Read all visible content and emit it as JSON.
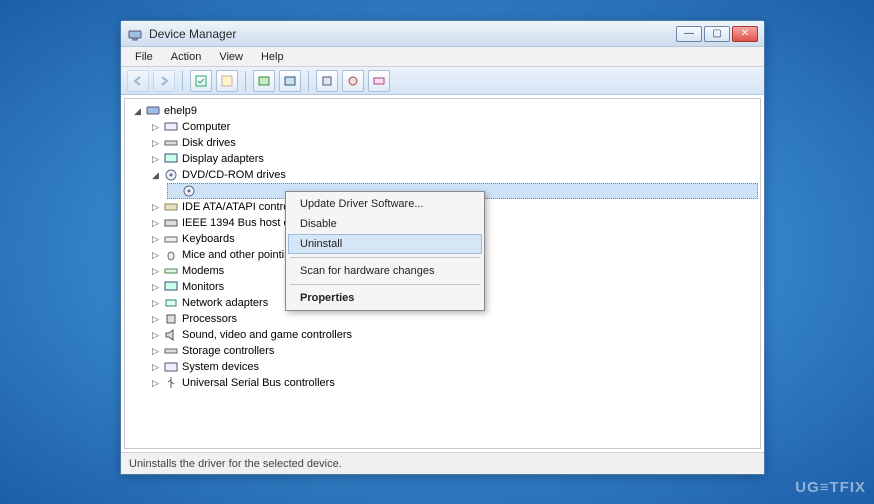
{
  "window": {
    "title": "Device Manager"
  },
  "menubar": {
    "file": "File",
    "action": "Action",
    "view": "View",
    "help": "Help"
  },
  "tree": {
    "root": "ehelp9",
    "items": {
      "computer": "Computer",
      "disk": "Disk drives",
      "display": "Display adapters",
      "dvd": "DVD/CD-ROM drives",
      "dvd_child": "",
      "ide": "IDE ATA/ATAPI controll",
      "ieee": "IEEE 1394 Bus host cont",
      "keyboards": "Keyboards",
      "mice": "Mice and other pointing",
      "modems": "Modems",
      "monitors": "Monitors",
      "network": "Network adapters",
      "processors": "Processors",
      "sound": "Sound, video and game controllers",
      "storage": "Storage controllers",
      "system": "System devices",
      "usb": "Universal Serial Bus controllers"
    }
  },
  "context_menu": {
    "update": "Update Driver Software...",
    "disable": "Disable",
    "uninstall": "Uninstall",
    "scan": "Scan for hardware changes",
    "properties": "Properties"
  },
  "statusbar": {
    "text": "Uninstalls the driver for the selected device."
  },
  "watermark": "UG≡TFIX"
}
